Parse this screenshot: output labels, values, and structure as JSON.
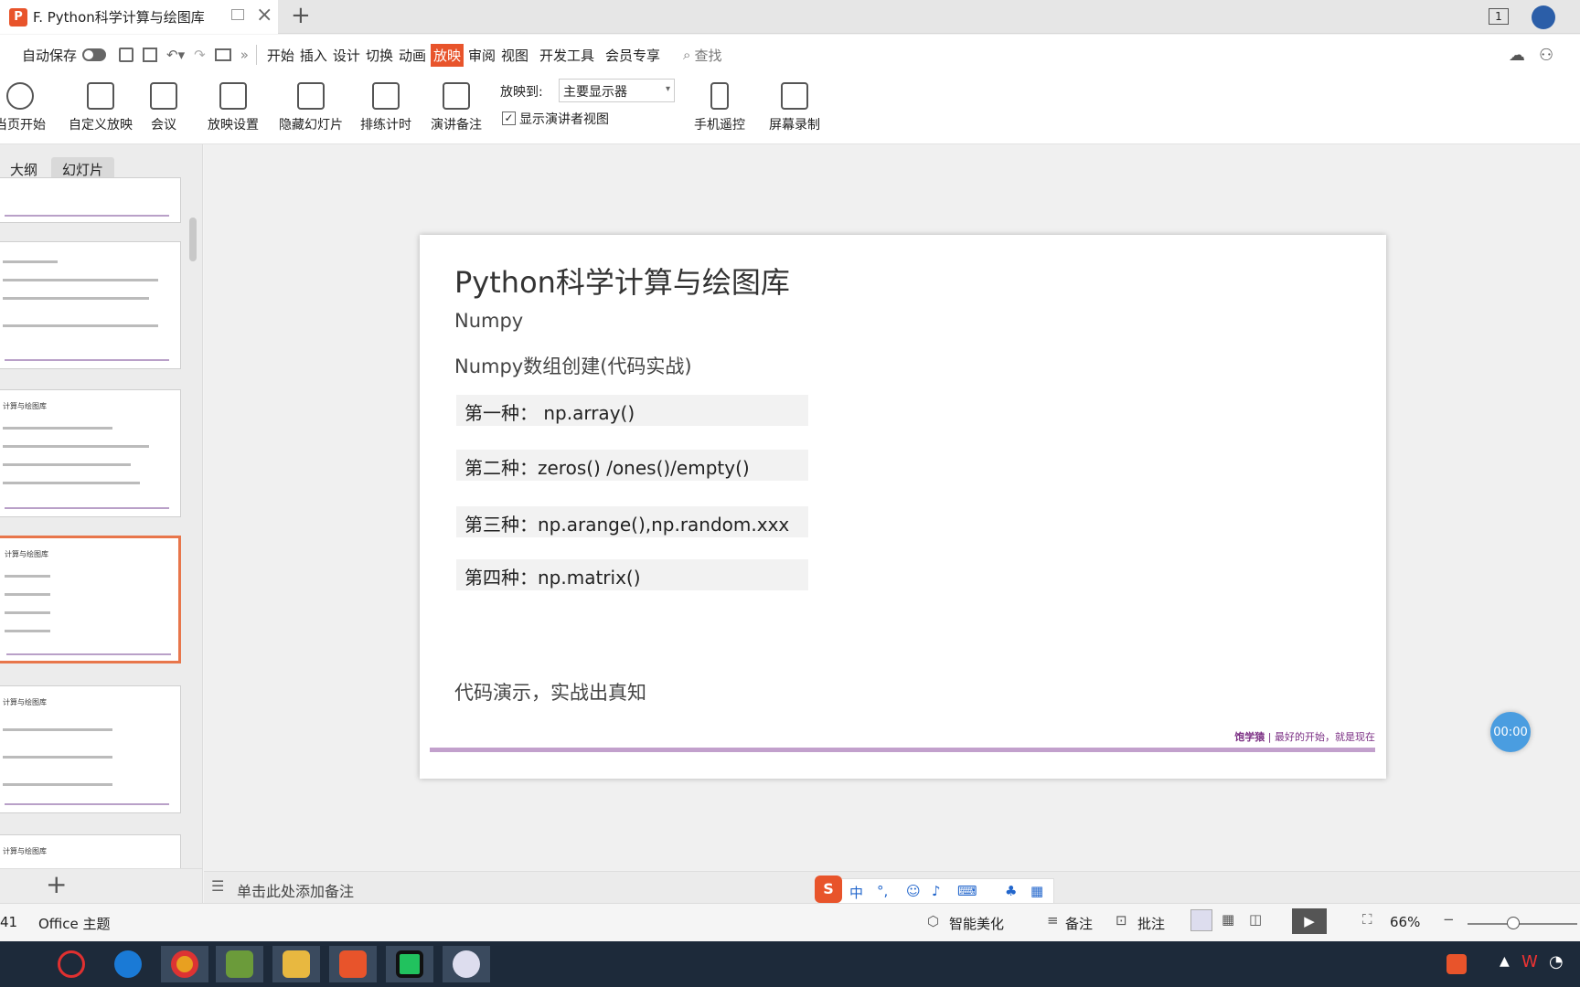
{
  "window": {
    "tab_title": "F. Python科学计算与绘图库",
    "page_count_badge": "1"
  },
  "menubar": {
    "autosave_label": "自动保存",
    "tabs": [
      "开始",
      "插入",
      "设计",
      "切换",
      "动画",
      "放映",
      "审阅",
      "视图",
      "开发工具",
      "会员专享"
    ],
    "active_tab": "放映",
    "search_label": "查找"
  },
  "ribbon": {
    "from_current": "当页开始",
    "custom_show": "自定义放映",
    "meeting": "会议",
    "show_settings": "放映设置",
    "hide_slide": "隐藏幻灯片",
    "rehearse": "排练计时",
    "speaker_notes": "演讲备注",
    "play_to_label": "放映到:",
    "play_to_value": "主要显示器",
    "presenter_view": "显示演讲者视图",
    "phone_remote": "手机遥控",
    "screen_record": "屏幕录制"
  },
  "sidepanel": {
    "tab_outline": "大纲",
    "tab_slides": "幻灯片",
    "thumb_title": "计算与绘图库"
  },
  "slide": {
    "title": "Python科学计算与绘图库",
    "subtitle": "Numpy",
    "heading": "Numpy数组创建(代码实战)",
    "items": [
      "第一种： np.array()",
      "第二种：zeros() /ones()/empty()",
      "第三种：np.arange(),np.random.xxx",
      "第四种：np.matrix()"
    ],
    "footer_text": "代码演示，实战出真知",
    "brand": "饱学猿",
    "slogan": "| 最好的开始，就是现在"
  },
  "timer": "00:00",
  "notes": {
    "placeholder": "单击此处添加备注"
  },
  "statusbar": {
    "slide_num": "41",
    "theme": "Office 主题",
    "beautify": "智能美化",
    "notes": "备注",
    "comments": "批注",
    "zoom": "66%"
  },
  "colors": {
    "accent": "#e8542b",
    "slide_bar": "#c2a0cc",
    "brand": "#7b2f84"
  }
}
